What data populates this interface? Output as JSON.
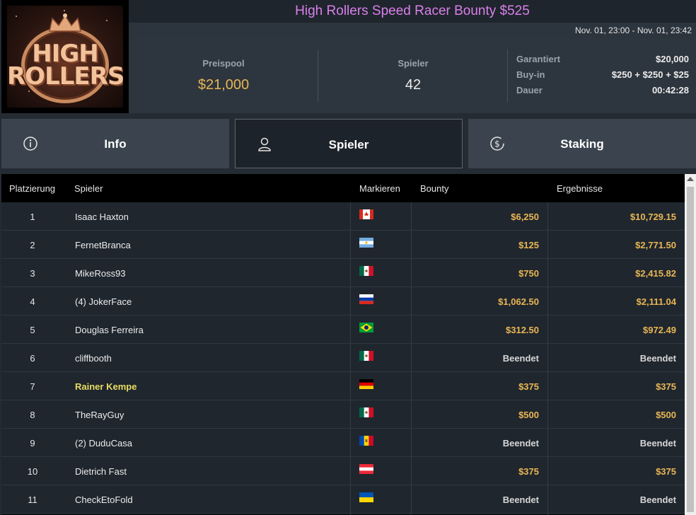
{
  "logo": {
    "line1": "HIGH",
    "line2": "ROLLERS"
  },
  "header": {
    "title": "High Rollers Speed Racer Bounty $525",
    "date_range": "Nov. 01, 23:00 - Nov. 01, 23:42"
  },
  "stats": {
    "pool_label": "Preispool",
    "pool_value": "$21,000",
    "players_label": "Spieler",
    "players_value": "42",
    "guaranteed_label": "Garantiert",
    "guaranteed_value": "$20,000",
    "buyin_label": "Buy-in",
    "buyin_value": "$250 + $250 + $25",
    "duration_label": "Dauer",
    "duration_value": "00:42:28"
  },
  "tabs": [
    {
      "label": "Info",
      "icon": "info-icon"
    },
    {
      "label": "Spieler",
      "icon": "user-icon"
    },
    {
      "label": "Staking",
      "icon": "dollar-coin-icon"
    }
  ],
  "table": {
    "headers": {
      "rank": "Platzierung",
      "player": "Spieler",
      "mark": "Markieren",
      "bounty": "Bounty",
      "result": "Ergebnisse"
    },
    "rows": [
      {
        "rank": "1",
        "player": "Isaac Haxton",
        "flag": "canada",
        "bounty": "$6,250",
        "result": "$10,729.15"
      },
      {
        "rank": "2",
        "player": "FernetBranca",
        "flag": "argentina",
        "bounty": "$125",
        "result": "$2,771.50"
      },
      {
        "rank": "3",
        "player": "MikeRoss93",
        "flag": "mexico",
        "bounty": "$750",
        "result": "$2,415.82"
      },
      {
        "rank": "4",
        "player": "(4) JokerFace",
        "flag": "russia",
        "bounty": "$1,062.50",
        "result": "$2,111.04"
      },
      {
        "rank": "5",
        "player": "Douglas Ferreira",
        "flag": "brazil",
        "bounty": "$312.50",
        "result": "$972.49"
      },
      {
        "rank": "6",
        "player": "cliffbooth",
        "flag": "mexico",
        "bounty": "Beendet",
        "result": "Beendet"
      },
      {
        "rank": "7",
        "player": "Rainer Kempe",
        "flag": "germany",
        "bounty": "$375",
        "result": "$375"
      },
      {
        "rank": "8",
        "player": "TheRayGuy",
        "flag": "mexico",
        "bounty": "$500",
        "result": "$500"
      },
      {
        "rank": "9",
        "player": "(2) DuduCasa",
        "flag": "moldova",
        "bounty": "Beendet",
        "result": "Beendet"
      },
      {
        "rank": "10",
        "player": "Dietrich Fast",
        "flag": "austria",
        "bounty": "$375",
        "result": "$375"
      },
      {
        "rank": "11",
        "player": "CheckEtoFold",
        "flag": "ukraine",
        "bounty": "Beendet",
        "result": "Beendet"
      }
    ]
  },
  "colors": {
    "title": "#d980ec",
    "money": "#e9b654",
    "highlight_player": "#e8dc62"
  }
}
